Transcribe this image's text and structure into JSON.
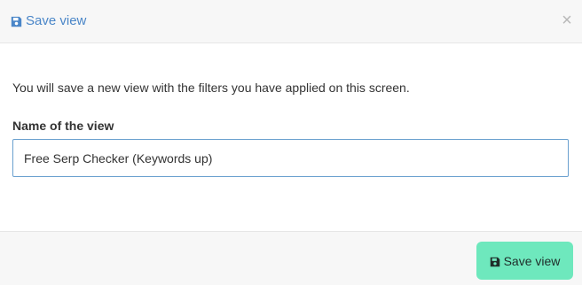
{
  "modal": {
    "title": "Save view",
    "title_icon": "floppy-disk-icon",
    "close_label": "×",
    "close_icon": "close-icon",
    "intro_text": "You will save a new view with the filters you have applied on this screen.",
    "field_label": "Name of the view",
    "name_value": "Free Serp Checker (Keywords up)",
    "save_button_label": "Save view",
    "save_button_icon": "floppy-disk-icon"
  },
  "colors": {
    "title_color": "#4a86c8",
    "save_button_bg": "#6ee8bd",
    "input_border": "#6aa0cf",
    "header_bg": "#f7f7f7"
  }
}
